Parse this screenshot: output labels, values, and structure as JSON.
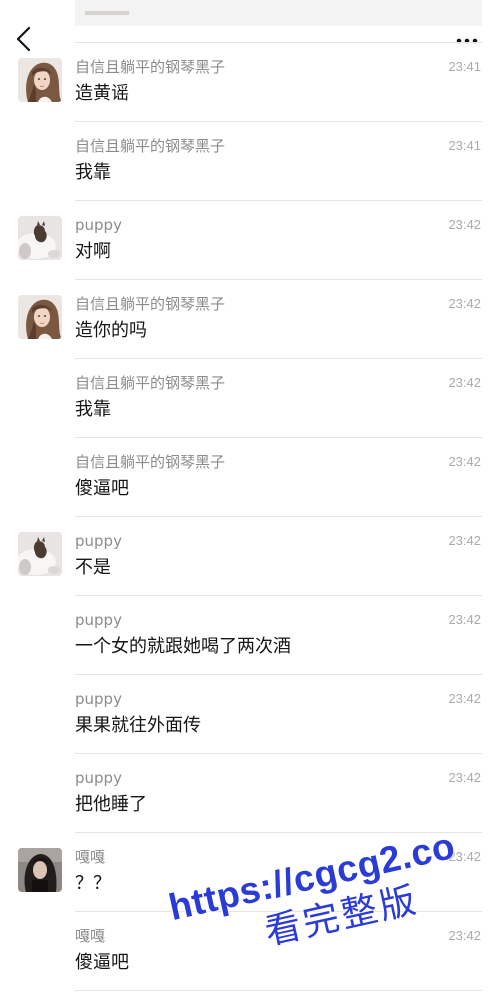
{
  "header": {
    "back_icon": "chevron-left-icon",
    "more_icon": "more-dots-icon"
  },
  "messages": [
    {
      "sender": "自信且躺平的钢琴黑子",
      "time": "23:41",
      "text": "造黄谣"
    },
    {
      "sender": "自信且躺平的钢琴黑子",
      "time": "23:41",
      "text": "我靠"
    },
    {
      "sender": "puppy",
      "time": "23:42",
      "text": "对啊"
    },
    {
      "sender": "自信且躺平的钢琴黑子",
      "time": "23:42",
      "text": "造你的吗"
    },
    {
      "sender": "自信且躺平的钢琴黑子",
      "time": "23:42",
      "text": "我靠"
    },
    {
      "sender": "自信且躺平的钢琴黑子",
      "time": "23:42",
      "text": "傻逼吧"
    },
    {
      "sender": "puppy",
      "time": "23:42",
      "text": "不是"
    },
    {
      "sender": "puppy",
      "time": "23:42",
      "text": "一个女的就跟她喝了两次酒"
    },
    {
      "sender": "puppy",
      "time": "23:42",
      "text": "果果就往外面传"
    },
    {
      "sender": "puppy",
      "time": "23:42",
      "text": "把他睡了"
    },
    {
      "sender": "嘎嘎",
      "time": "23:42",
      "text": "？？"
    },
    {
      "sender": "嘎嘎",
      "time": "23:42",
      "text": "傻逼吧"
    }
  ],
  "watermark": {
    "url": "https://cgcg2.co",
    "caption": "看完整版"
  },
  "colors": {
    "sender_name": "#8c8c8c",
    "time": "#ababab",
    "message_text": "#161616",
    "divider": "#e5e5e5",
    "watermark": "#2b3bd6"
  }
}
